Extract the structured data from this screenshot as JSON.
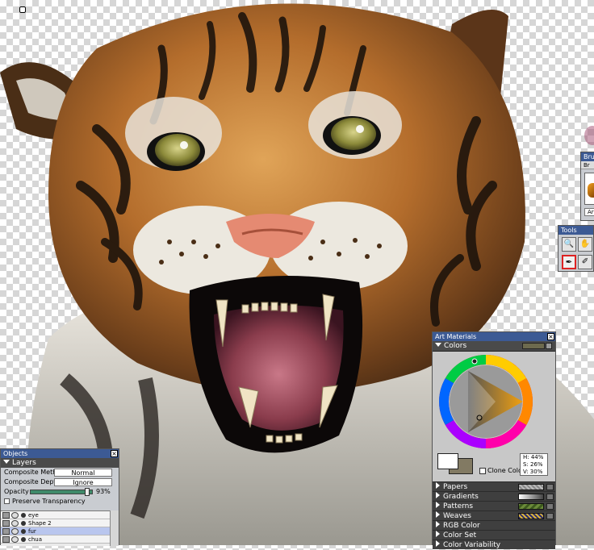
{
  "art_materials": {
    "title": "Art Materials",
    "colors_label": "Colors",
    "clone_color_label": "Clone Color",
    "hsv": {
      "h": "H: 44%",
      "s": "S: 26%",
      "v": "V: 30%"
    },
    "primary_color": "#ffffff",
    "secondary_color": "#827a63",
    "rows": [
      {
        "label": "Papers"
      },
      {
        "label": "Gradients"
      },
      {
        "label": "Patterns"
      },
      {
        "label": "Weaves"
      },
      {
        "label": "RGB Color"
      },
      {
        "label": "Color Set"
      },
      {
        "label": "Color Variability"
      }
    ]
  },
  "objects": {
    "title": "Objects",
    "layers_label": "Layers",
    "composite_method_label": "Composite Method:",
    "composite_method_value": "Normal",
    "composite_depth_label": "Composite Depth:",
    "composite_depth_value": "Ignore",
    "opacity_label": "Opacity",
    "opacity_value": "93%",
    "opacity_fraction": 0.93,
    "preserve_transparency_label": "Preserve Transparency",
    "layers": [
      {
        "name": "eye"
      },
      {
        "name": "Shape 2"
      },
      {
        "name": "fur"
      },
      {
        "name": "chua"
      }
    ]
  },
  "tools": {
    "title": "Tools",
    "items": [
      "magnifier-icon",
      "grabber-hand-icon",
      "brush-icon",
      "dropper-icon"
    ]
  },
  "brush": {
    "title": "Brus",
    "category": "Br",
    "variant": "Art"
  }
}
